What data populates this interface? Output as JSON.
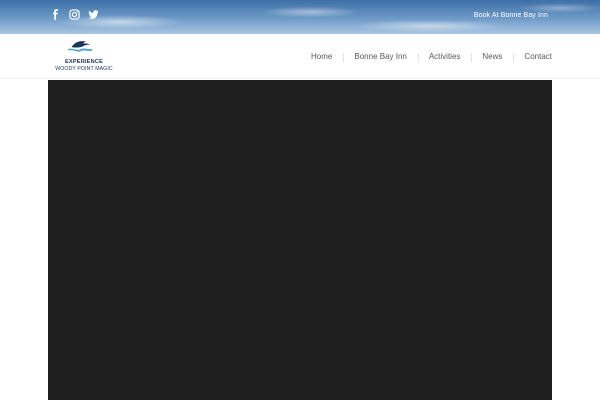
{
  "topbar": {
    "social_icons": [
      "facebook-icon",
      "instagram-icon",
      "twitter-icon"
    ],
    "book_link": "Book At Bonne Bay Inn"
  },
  "header": {
    "logo": {
      "line1": "EXPERIENCE",
      "line2": "WOODY POINT MAGIC"
    },
    "nav": [
      "Home",
      "Bonne Bay Inn",
      "Activities",
      "News",
      "Contact"
    ]
  },
  "colors": {
    "sky": "#6f9bc8",
    "logo_text": "#1d3557",
    "nav_text": "#5a5a5a",
    "video_bg": "#1e1e1e"
  }
}
